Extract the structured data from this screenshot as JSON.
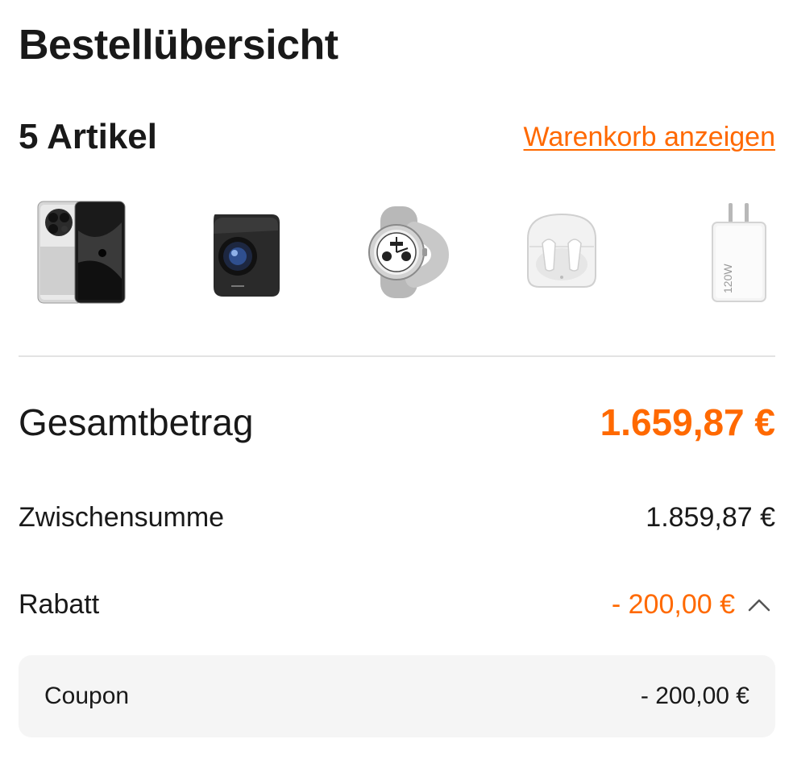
{
  "page": {
    "title": "Bestellübersicht"
  },
  "items": {
    "count_label": "5 Artikel",
    "view_cart_label": "Warenkorb anzeigen",
    "products": [
      {
        "icon": "smartphone-image"
      },
      {
        "icon": "projector-image"
      },
      {
        "icon": "smartwatch-image"
      },
      {
        "icon": "earbuds-image"
      },
      {
        "icon": "charger-image",
        "badge": "120W"
      }
    ]
  },
  "summary": {
    "total_label": "Gesamtbetrag",
    "total_value": "1.659,87 €",
    "subtotal_label": "Zwischensumme",
    "subtotal_value": "1.859,87 €",
    "discount_label": "Rabatt",
    "discount_value": "- 200,00 €",
    "discount_toggle_icon": "chevron-up-icon",
    "coupon_label": "Coupon",
    "coupon_value": "- 200,00 €"
  },
  "colors": {
    "accent": "#ff6900",
    "text": "#191919",
    "divider": "#e3e3e3",
    "panel": "#f5f5f5"
  }
}
